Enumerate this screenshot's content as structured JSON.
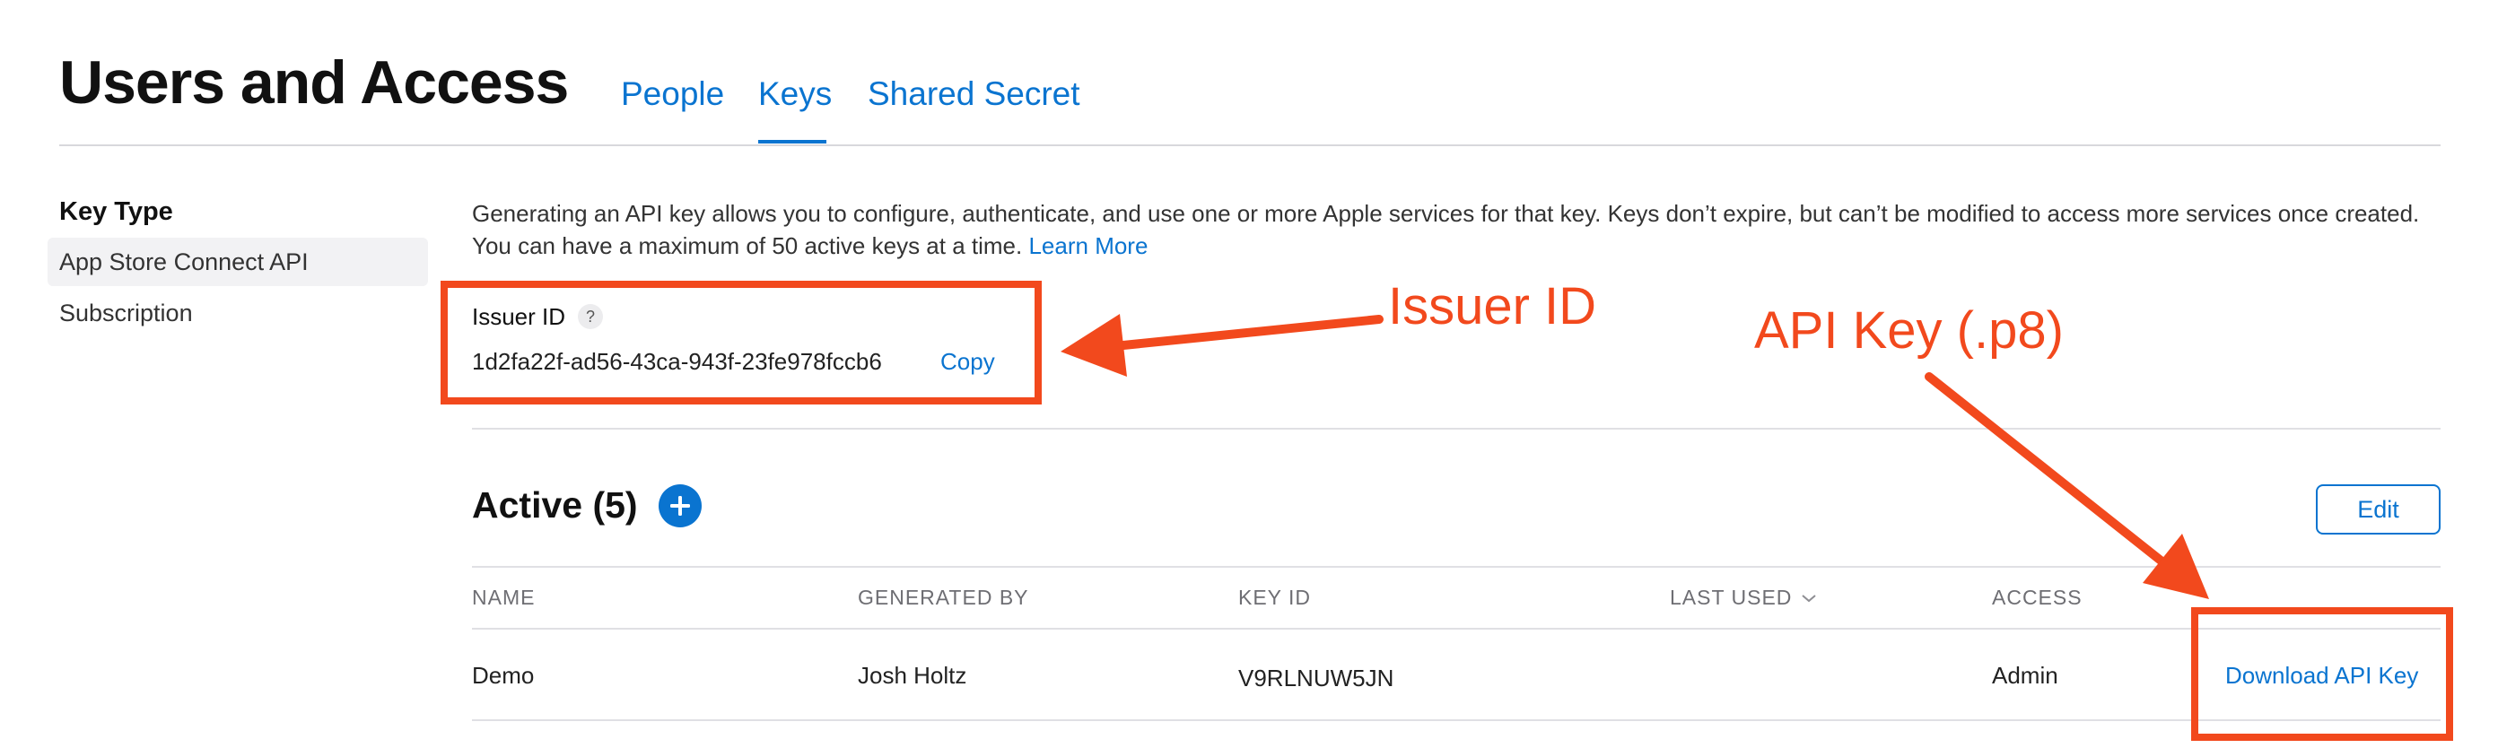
{
  "header": {
    "title": "Users and Access",
    "tabs": [
      {
        "label": "People",
        "active": false
      },
      {
        "label": "Keys",
        "active": true
      },
      {
        "label": "Shared Secret",
        "active": false
      }
    ]
  },
  "sidebar": {
    "title": "Key Type",
    "items": [
      {
        "label": "App Store Connect API",
        "selected": true
      },
      {
        "label": "Subscription",
        "selected": false
      }
    ]
  },
  "main": {
    "description": "Generating an API key allows you to configure, authenticate, and use one or more Apple services for that key. Keys don’t expire, but can’t be modified to access more services once created. You can have a maximum of 50 active keys at a time.",
    "learn_more": "Learn More",
    "issuer": {
      "label": "Issuer ID",
      "help": "?",
      "value": "1d2fa22f-ad56-43ca-943f-23fe978fccb6",
      "copy_label": "Copy"
    },
    "active": {
      "title": "Active (5)",
      "edit_label": "Edit"
    },
    "table": {
      "columns": [
        "NAME",
        "GENERATED BY",
        "KEY ID",
        "LAST USED",
        "ACCESS"
      ],
      "rows": [
        {
          "name": "Demo",
          "generated_by": "Josh Holtz",
          "key_id": "V9RLNUW5JN",
          "last_used": "",
          "access": "Admin",
          "action": "Download API Key"
        }
      ]
    }
  },
  "annotations": {
    "issuer_label": "Issuer ID",
    "api_key_label": "API Key (.p8)",
    "color": "#f2491d"
  },
  "colors": {
    "accent": "#0a74d0",
    "annotation": "#f2491d"
  }
}
